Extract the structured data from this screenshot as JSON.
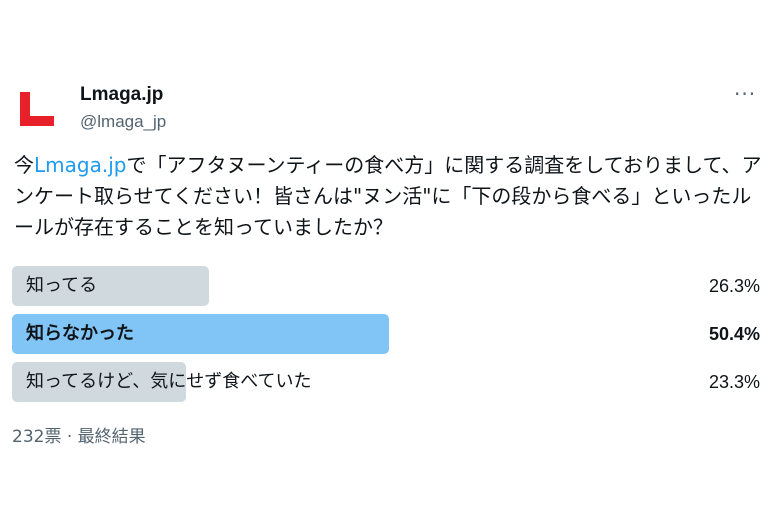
{
  "account": {
    "display_name": "Lmaga.jp",
    "handle": "@lmaga_jp",
    "logo_color": "#e8202a",
    "avatar_icon": "lmaga-l-logo"
  },
  "more_menu": {
    "glyph": "···"
  },
  "tweet": {
    "part1": "今",
    "link": "Lmaga.jp",
    "part2": "で「アフタヌーンティーの食べ方」に関する調査をしておりまして、アンケート取らせてください！皆さんは\"ヌン活\"に「下の段から食べる」といったルールが存在することを知っていましたか？",
    "link_color": "#1d9bf0"
  },
  "poll": {
    "options": [
      {
        "label": "知ってる",
        "percent": "26.3%",
        "share": 0.263
      },
      {
        "label": "知らなかった",
        "percent": "50.4%",
        "share": 0.504,
        "winner": true
      },
      {
        "label": "知ってるけど、気にせず食べていた",
        "percent": "23.3%",
        "share": 0.233
      }
    ],
    "bar_color": "#cfd9de",
    "winner_bar_color": "#80c5f5",
    "footer": "232票 · 最終結果"
  }
}
